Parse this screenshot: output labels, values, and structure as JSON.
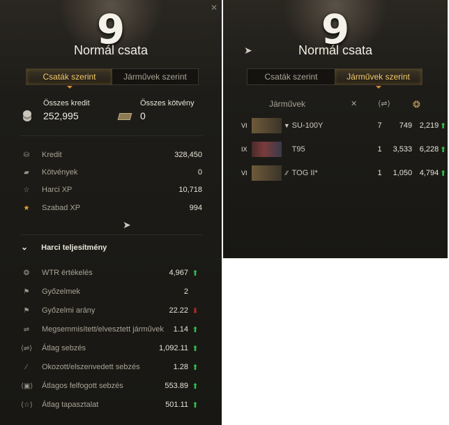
{
  "left_panel": {
    "tier": "9",
    "title": "Normál csata",
    "close": "✕",
    "tabs": [
      {
        "label": "Csaták szerint",
        "active": true
      },
      {
        "label": "Járművek szerint",
        "active": false
      }
    ],
    "summary": {
      "credits_label": "Összes kredit",
      "credits_value": "252,995",
      "bonds_label": "Összes kötvény",
      "bonds_value": "0"
    },
    "stats": [
      {
        "icon": "credit-icon",
        "glyph": "⛁",
        "label": "Kredit",
        "value": "328,450"
      },
      {
        "icon": "bond-icon",
        "glyph": "▰",
        "label": "Kötvények",
        "value": "0"
      },
      {
        "icon": "combat-xp-icon",
        "glyph": "☆",
        "label": "Harci XP",
        "value": "10,718"
      },
      {
        "icon": "free-xp-icon",
        "glyph": "★",
        "label": "Szabad XP",
        "value": "994"
      }
    ],
    "performance": {
      "heading": "Harci teljesítmény",
      "rows": [
        {
          "icon": "wtr-icon",
          "glyph": "❂",
          "label": "WTR értékelés",
          "value": "4,967",
          "trend": "up"
        },
        {
          "icon": "victory-flag-icon",
          "glyph": "⚑",
          "label": "Győzelmek",
          "value": "2",
          "trend": ""
        },
        {
          "icon": "win-rate-flag-icon",
          "glyph": "⚑",
          "label": "Győzelmi arány",
          "value": "22.22",
          "trend": "down"
        },
        {
          "icon": "kill-death-icon",
          "glyph": "⇌",
          "label": "Megsemmisített/elvesztett járművek",
          "value": "1.14",
          "trend": "up"
        },
        {
          "icon": "damage-icon",
          "glyph": "⟨⇌⟩",
          "label": "Átlag sebzés",
          "value": "1,092.11",
          "trend": "up"
        },
        {
          "icon": "damage-ratio-icon",
          "glyph": "⁄",
          "label": "Okozott/elszenvedett sebzés",
          "value": "1.28",
          "trend": "up"
        },
        {
          "icon": "blocked-damage-icon",
          "glyph": "⟨▣⟩",
          "label": "Átlagos felfogott sebzés",
          "value": "553.89",
          "trend": "up"
        },
        {
          "icon": "avg-xp-icon",
          "glyph": "⟨☆⟩",
          "label": "Átlag tapasztalat",
          "value": "501.11",
          "trend": "up"
        }
      ]
    }
  },
  "right_panel": {
    "tier": "9",
    "title": "Normál csata",
    "tabs": [
      {
        "label": "Csaták szerint",
        "active": false
      },
      {
        "label": "Járművek szerint",
        "active": true
      }
    ],
    "vehicles_header": "Járművek",
    "column_icons": [
      "battles-icon",
      "damage-icon",
      "wtr-icon"
    ],
    "vehicles": [
      {
        "tier": "VI",
        "name": "SU-100Y",
        "battles": "7",
        "damage": "749",
        "wtr": "2,219",
        "trend": "up",
        "flag": false,
        "mark": "▼"
      },
      {
        "tier": "IX",
        "name": "T95",
        "battles": "1",
        "damage": "3,533",
        "wtr": "6,228",
        "trend": "up",
        "flag": true,
        "mark": ""
      },
      {
        "tier": "VI",
        "name": "TOG II*",
        "battles": "1",
        "damage": "1,050",
        "wtr": "4,794",
        "trend": "up",
        "flag": false,
        "mark": "⁄⁄"
      }
    ]
  },
  "arrows": {
    "up": "⬆",
    "down": "⬇"
  }
}
